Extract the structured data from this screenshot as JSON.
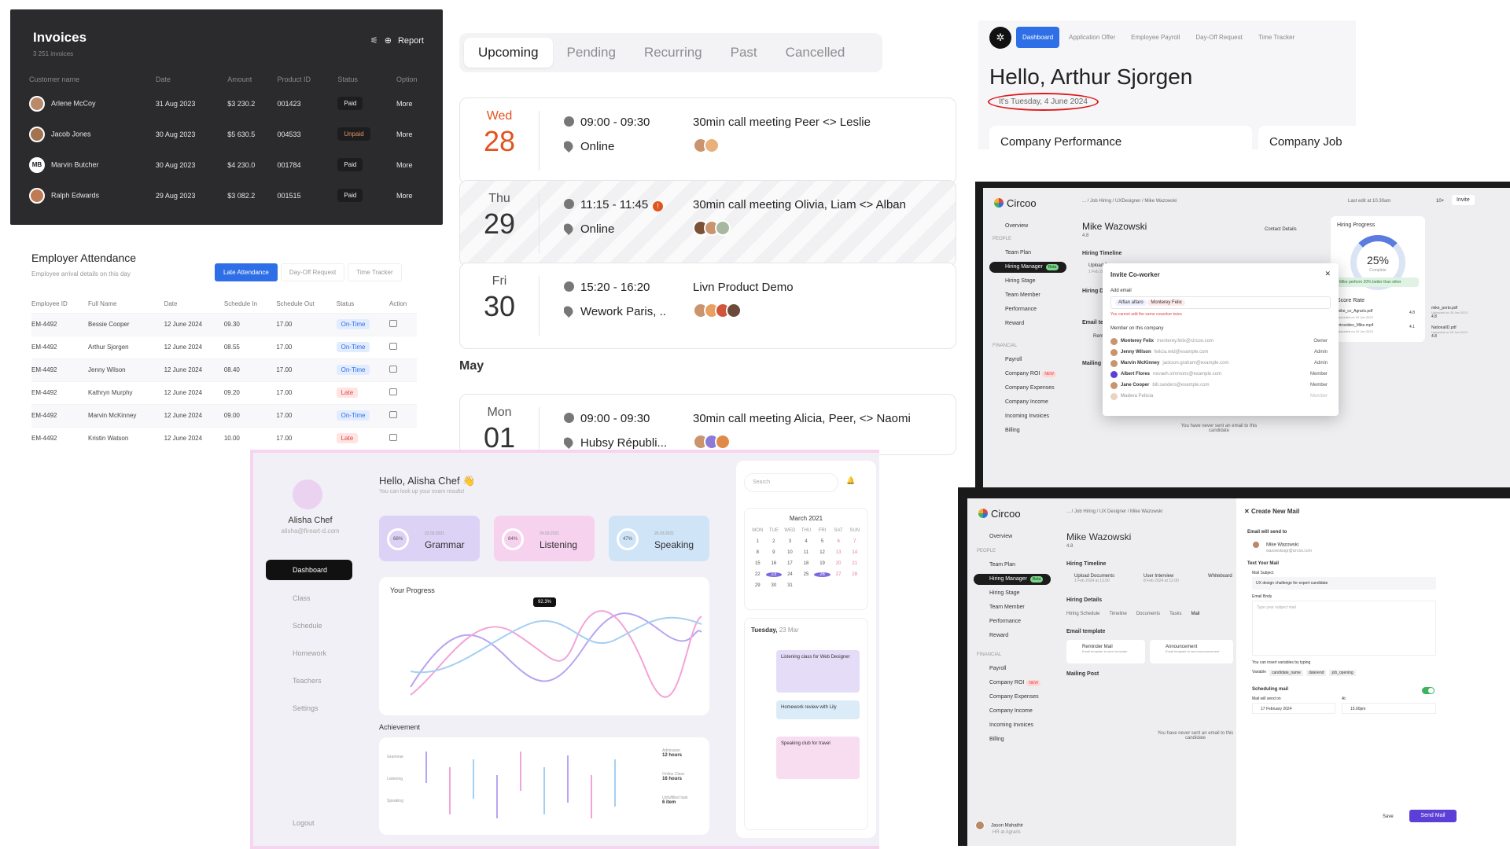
{
  "invoices": {
    "title": "Invoices",
    "subtitle": "3 251 invoices",
    "report": "Report",
    "headers": [
      "Customer name",
      "Date",
      "Amount",
      "Product ID",
      "Status",
      "Option"
    ],
    "rows": [
      {
        "name": "Arlene McCoy",
        "date": "31 Aug 2023",
        "amount": "$3 230.2",
        "pid": "001423",
        "status": "Paid",
        "opt": "More"
      },
      {
        "name": "Jacob Jones",
        "date": "30 Aug 2023",
        "amount": "$5 630.5",
        "pid": "004533",
        "status": "Unpaid",
        "opt": "More"
      },
      {
        "name": "Marvin Butcher",
        "initials": "MB",
        "date": "30 Aug 2023",
        "amount": "$4 230.0",
        "pid": "001784",
        "status": "Paid",
        "opt": "More"
      },
      {
        "name": "Ralph Edwards",
        "date": "29 Aug 2023",
        "amount": "$3 082.2",
        "pid": "001515",
        "status": "Paid",
        "opt": "More"
      }
    ]
  },
  "schedule": {
    "tabs": [
      "Upcoming",
      "Pending",
      "Recurring",
      "Past",
      "Cancelled"
    ],
    "month": "May",
    "events": [
      {
        "dow": "Wed",
        "day": "28",
        "time": "09:00 - 09:30",
        "loc": "Online",
        "title": "30min call meeting Peer <> Leslie"
      },
      {
        "dow": "Thu",
        "day": "29",
        "time": "11:15 - 11:45",
        "alert": "!",
        "loc": "Online",
        "title": "30min call meeting Olivia, Liam <> Alban"
      },
      {
        "dow": "Fri",
        "day": "30",
        "time": "15:20 - 16:20",
        "loc": "Wework Paris, ...",
        "title": "Livn Product Demo"
      },
      {
        "dow": "Mon",
        "day": "01",
        "time": "09:00 - 09:30",
        "loc": "Hubsy Républi...",
        "title": "30min call meeting Alicia, Peer, <> Naomi"
      }
    ]
  },
  "hello": {
    "logo": "✲",
    "nav": [
      "Dashboard",
      "Application Offer",
      "Employee Payroll",
      "Day-Off Request",
      "Time Tracker"
    ],
    "greeting": "Hello, Arthur Sjorgen",
    "date": "It's Tuesday, 4 June 2024",
    "card1": "Company Performance",
    "card2": "Company Job Le"
  },
  "attendance": {
    "title": "Employer Attendance",
    "subtitle": "Employee arrival details on this day",
    "tabs": [
      "Late Attendance",
      "Day-Off Request",
      "Time Tracker"
    ],
    "headers": [
      "Employee ID",
      "Full Name",
      "Date",
      "Schedule In",
      "Schedule Out",
      "Status",
      "Action"
    ],
    "rows": [
      {
        "id": "EM-4492",
        "name": "Bessie Cooper",
        "date": "12 June 2024",
        "in": "09.30",
        "out": "17.00",
        "status": "On-Time"
      },
      {
        "id": "EM-4492",
        "name": "Arthur Sjorgen",
        "date": "12 June 2024",
        "in": "08.55",
        "out": "17.00",
        "status": "On-Time"
      },
      {
        "id": "EM-4492",
        "name": "Jenny Wilson",
        "date": "12 June 2024",
        "in": "08.40",
        "out": "17.00",
        "status": "On-Time"
      },
      {
        "id": "EM-4492",
        "name": "Kathryn Murphy",
        "date": "12 June 2024",
        "in": "09.20",
        "out": "17.00",
        "status": "Late"
      },
      {
        "id": "EM-4492",
        "name": "Marvin McKinney",
        "date": "12 June 2024",
        "in": "09.00",
        "out": "17.00",
        "status": "On-Time"
      },
      {
        "id": "EM-4492",
        "name": "Kristin Watson",
        "date": "12 June 2024",
        "in": "10.00",
        "out": "17.00",
        "status": "Late"
      }
    ]
  },
  "edu": {
    "name": "Alisha Chef",
    "email": "alisha@fireart-d.com",
    "nav": [
      "Dashboard",
      "Class",
      "Schedule",
      "Homework",
      "Teachers",
      "Settings"
    ],
    "logout": "Logout",
    "greeting": "Hello, Alisha Chef 👋",
    "sub": "You can look up your exam results!",
    "cards": [
      {
        "pct": "68%",
        "date": "22.03.2021",
        "name": "Grammar",
        "color": "#dcd2f5"
      },
      {
        "pct": "84%",
        "date": "24.03.2021",
        "name": "Listening",
        "color": "#f7d2ee"
      },
      {
        "pct": "47%",
        "date": "26.03.2021",
        "name": "Speaking",
        "color": "#cfe4f7"
      }
    ],
    "progress": "Your Progress",
    "tooltip": "92.3%",
    "achievement": "Achievement",
    "ach_rows": [
      "Grammar",
      "Listening",
      "Speaking"
    ],
    "ach_legend": [
      {
        "label": "Admission",
        "value": "12 hours"
      },
      {
        "label": "Online Class",
        "value": "16 hours"
      },
      {
        "label": "Unfulfilled task",
        "value": "6 item"
      }
    ],
    "search": "Search",
    "month": "March 2021",
    "weekdays": [
      "MON",
      "TUE",
      "WED",
      "THU",
      "FRI",
      "SAT",
      "SUN"
    ],
    "sched_day": "Tuesday,",
    "sched_date": "23 Mar",
    "sched_events": [
      "Listening class for Web Designer",
      "Homework review with Lily",
      "Speaking club for travel"
    ]
  },
  "circoo1": {
    "logo": "Circoo",
    "breadcrumb": "... / Job Hiring / UXDesigner / Mike Wazowski",
    "last_edit": "Last edit at 10.30am",
    "plus": "10+",
    "invite": "Invite",
    "overview": "Overview",
    "people": "PEOPLE",
    "items": [
      "Team Plan",
      "Hiring Manager",
      "Hiring Stage",
      "Team Member",
      "Performance",
      "Reward"
    ],
    "financial": "FINANCIAL",
    "fitems": [
      "Payroll",
      "Company ROI",
      "Company Expenses",
      "Company Income",
      "Incoming Invoices",
      "Billing"
    ],
    "beta": "Beta",
    "new": "NEW",
    "person": "Mike Wazowski",
    "rating": "4.8",
    "contact": "Contact Details",
    "timeline": "Hiring Timeline",
    "upload": "Upload Doc",
    "upload_date": "1 Feb 2024 at",
    "details": "Hiring Details",
    "email_tpl": "Email template",
    "reminder": "Reminder",
    "mailing": "Mailing Post",
    "empty": "You have never sent an email to this candidate",
    "progress": "Hiring Progress",
    "pct": "25%",
    "complete": "Complete",
    "perf": "Mike perform 20% better than other",
    "score": "Score Rate",
    "files": [
      {
        "n": "mike_cv_Agraris.pdf",
        "d": "Uploaded on 25 Jan 2023",
        "r": "4.8"
      },
      {
        "n": "Introvideo_Mike.mp4",
        "d": "Uploaded on 24 Jan 2023",
        "r": "4.1"
      },
      {
        "n": "mike_porto.pdf",
        "d": "Uploaded on 26 Jan 2023",
        "r": "4.8"
      },
      {
        "n": "NationalID.pdf",
        "d": "Uploaded on 25 Jan 2023",
        "r": "4.8"
      }
    ],
    "modal": {
      "title": "Invite Co-worker",
      "add": "Add email",
      "chips": [
        "Alfian alfaro",
        "Monterey Felix"
      ],
      "error": "You cannot add the same coworker twice",
      "members_title": "Member on this company",
      "members": [
        {
          "n": "Monterey Felix",
          "e": "monterey.felix@circoo.com",
          "r": "Owner"
        },
        {
          "n": "Jenny Wilson",
          "e": "felicia.reid@example.com",
          "r": "Admin"
        },
        {
          "n": "Marvin McKinney",
          "e": "jackson.graham@example.com",
          "r": "Admin"
        },
        {
          "n": "Albert Flores",
          "e": "nevaeh.simmons@example.com",
          "r": "Member"
        },
        {
          "n": "Jane Cooper",
          "e": "bill.sanders@example.com",
          "r": "Member"
        },
        {
          "n": "Madera Felicia",
          "e": "",
          "r": "Member"
        }
      ]
    }
  },
  "circoo2": {
    "breadcrumb": "... / Job Hiring / UX Designer / Mike Wazowski",
    "upload": "Upload Documents",
    "upload_d": "1 Feb 2024 at 13.00",
    "interview": "User Interview",
    "interview_d": "8 Feb 2024 at 12.00",
    "whiteboard": "Whiteboard",
    "tabs": [
      "Hiring Schedule",
      "Timeline",
      "Documents",
      "Tasks",
      "Mail"
    ],
    "ann": "Announcement",
    "ann_d": "Email template to send announcement",
    "rem": "Reminder Mail",
    "rem_d": "Email template to send reminder",
    "user": "Jason Mahathir",
    "user_role": "HR at Agraris",
    "mail": {
      "title": "Create New Mail",
      "send_to": "Email will send to",
      "to_name": "Mike Wazowski",
      "to_email": "wazowskiagr@circoo.com",
      "text": "Text Your Mail",
      "subject_l": "Mail Subject",
      "subject": "UX design challenge for expert candidate",
      "body_l": "Email Body",
      "body_ph": "Type your subject mail",
      "var_hint": "You can insert variables by typing",
      "var": "Variable",
      "vars": [
        "candidate_name",
        "date/end",
        "job_opening"
      ],
      "sched": "Scheduling mail",
      "send_on": "Mail will send on",
      "at": "At",
      "date": "17 February 2024",
      "time": "15.00pm",
      "save": "Save",
      "send": "Send Mail"
    }
  }
}
